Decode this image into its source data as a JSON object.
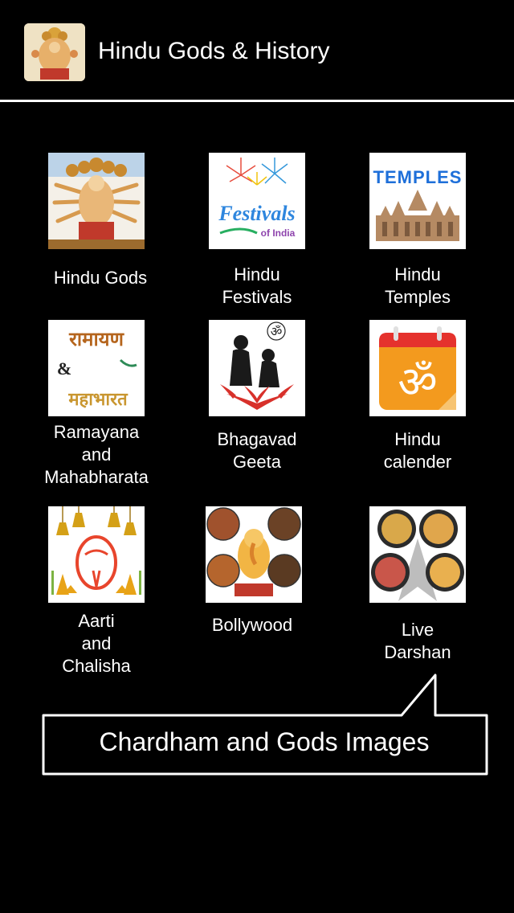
{
  "header": {
    "title": "Hindu Gods & History"
  },
  "grid": {
    "items": [
      {
        "label": "Hindu Gods",
        "icon": "hindu-gods-image"
      },
      {
        "label": "Hindu\nFestivals",
        "icon": "festivals-of-india-image"
      },
      {
        "label": "Hindu\nTemples",
        "icon": "temples-image"
      },
      {
        "label": "Ramayana\nand\nMahabharata",
        "icon": "ramayana-mahabharata-image"
      },
      {
        "label": "Bhagavad\nGeeta",
        "icon": "bhagavad-geeta-image"
      },
      {
        "label": "Hindu\ncalender",
        "icon": "om-calendar-image"
      },
      {
        "label": "Aarti\nand\nChalisha",
        "icon": "aarti-bells-image"
      },
      {
        "label": "Bollywood",
        "icon": "bollywood-collage-image"
      },
      {
        "label": "Live\nDarshan",
        "icon": "live-darshan-collage-image"
      }
    ],
    "thumb_texts": {
      "temples": "TEMPLES",
      "festivals": "Festivals",
      "festivals_sub": "of India",
      "ramayana": "रामायण",
      "ampersand": "&",
      "mahabharat": "महाभारत",
      "om": "ॐ"
    }
  },
  "callout": {
    "text": "Chardham and Gods Images"
  },
  "colors": {
    "background": "#000000",
    "text": "#ffffff",
    "calendar_orange": "#f39a1e",
    "calendar_red": "#e5322d"
  }
}
